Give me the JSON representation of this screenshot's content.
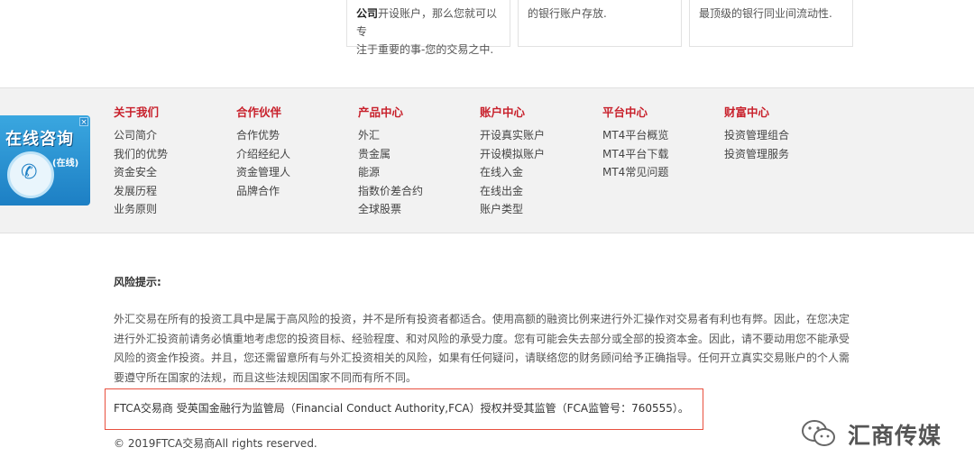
{
  "top_cards": [
    {
      "bold": "公司",
      "line1": "开设账户，那么您就可以专",
      "line2": "注于重要的事-您的交易之中."
    },
    {
      "line1": "的银行账户存放."
    },
    {
      "line1": "最顶级的银行同业间流动性."
    }
  ],
  "consult_widget": {
    "title": "在线咨询",
    "online": "(在线)",
    "close": "×"
  },
  "footer_columns": [
    {
      "title": "关于我们",
      "links": [
        "公司简介",
        "我们的优势",
        "资金安全",
        "发展历程",
        "业务原则"
      ]
    },
    {
      "title": "合作伙伴",
      "links": [
        "合作优势",
        "介绍经纪人",
        "资金管理人",
        "品牌合作"
      ]
    },
    {
      "title": "产品中心",
      "links": [
        "外汇",
        "贵金属",
        "能源",
        "指数价差合约",
        "全球股票"
      ]
    },
    {
      "title": "账户中心",
      "links": [
        "开设真实账户",
        "开设模拟账户",
        "在线入金",
        "在线出金",
        "账户类型"
      ]
    },
    {
      "title": "平台中心",
      "links": [
        "MT4平台概览",
        "MT4平台下载",
        "MT4常见问题"
      ]
    },
    {
      "title": "财富中心",
      "links": [
        "投资管理组合",
        "投资管理服务"
      ]
    }
  ],
  "risk": {
    "title": "风险提示:",
    "body": "外汇交易在所有的投资工具中是属于高风险的投资，并不是所有投资者都适合。使用高额的融资比例来进行外汇操作对交易者有利也有弊。因此，在您决定进行外汇投资前请务必慎重地考虑您的投资目标、经验程度、和对风险的承受力度。您有可能会失去部分或全部的投资本金。因此，请不要动用您不能承受风险的资金作投资。并且，您还需留意所有与外汇投资相关的风险，如果有任何疑问，请联络您的财务顾问给予正确指导。任何开立真实交易账户的个人需要遵守所在国家的法规，而且这些法规因国家不同而有所不同。"
  },
  "license": "FTCA交易商 受英国金融行为监管局（Financial Conduct Authority,FCA）授权并受其监管（FCA监管号：760555）。",
  "copyright": "© 2019FTCA交易商All rights reserved.",
  "watermark": {
    "text": "汇商传媒",
    "icon": "wechat-icon"
  },
  "colors": {
    "accent_red": "#c8202b",
    "highlight_box": "#e8503f",
    "widget_blue": "#1d7fc4"
  }
}
